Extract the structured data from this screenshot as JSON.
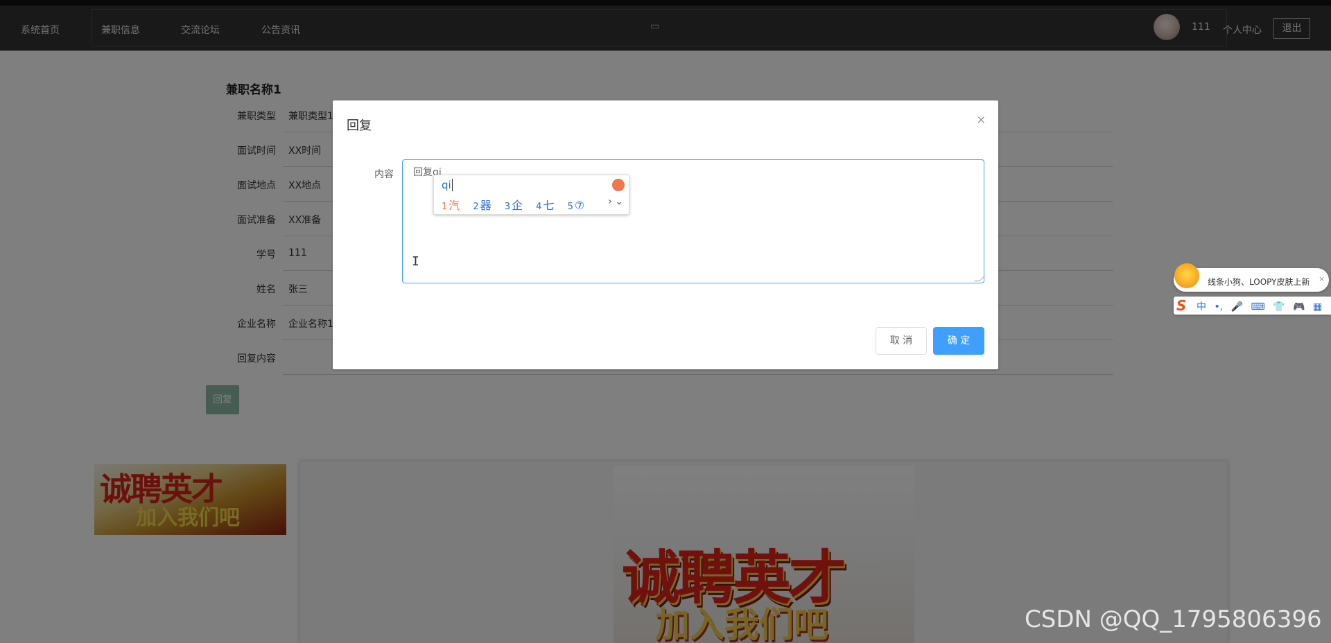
{
  "header": {
    "home": "系统首页",
    "nav": [
      "兼职信息",
      "交流论坛",
      "公告资讯"
    ],
    "user_id": "111",
    "user_center": "个人中心",
    "logout": "退出"
  },
  "job": {
    "title": "兼职名称1",
    "fields": [
      {
        "label": "兼职类型",
        "value": "兼职类型1"
      },
      {
        "label": "面试时间",
        "value": "XX时间"
      },
      {
        "label": "面试地点",
        "value": "XX地点"
      },
      {
        "label": "面试准备",
        "value": "XX准备"
      },
      {
        "label": "学号",
        "value": "111"
      },
      {
        "label": "姓名",
        "value": "张三"
      },
      {
        "label": "企业名称",
        "value": "企业名称1"
      },
      {
        "label": "回复内容",
        "value": ""
      }
    ],
    "reply_button": "回复"
  },
  "banner": {
    "line1": "诚聘英才",
    "line2": "加入我们吧"
  },
  "dialog": {
    "title": "回复",
    "close": "×",
    "content_label": "内容",
    "content_value": "回复qi",
    "cancel": "取 消",
    "confirm": "确 定"
  },
  "ime": {
    "input": "qi",
    "candidates": [
      {
        "num": "1",
        "text": "汽"
      },
      {
        "num": "2",
        "text": "器"
      },
      {
        "num": "3",
        "text": "企"
      },
      {
        "num": "4",
        "text": "七"
      },
      {
        "num": "5",
        "text": "⑦"
      }
    ],
    "nav": "› ⌄"
  },
  "sogou": {
    "tip": "线条小狗、LOOPY皮肤上新",
    "tip_close": "×",
    "lang": "中",
    "icons": [
      "•,",
      "🎤",
      "⌨",
      "👕",
      "🎮",
      "▦",
      "⚙"
    ]
  },
  "watermark": "CSDN @QQ_1795806396"
}
